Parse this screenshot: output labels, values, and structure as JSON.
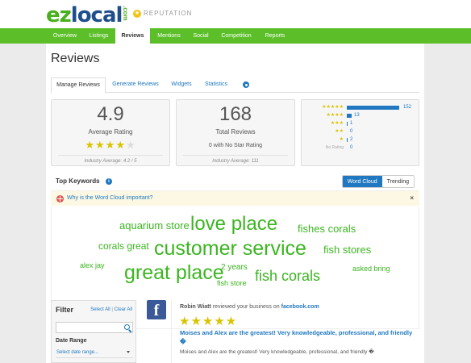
{
  "header": {
    "logo_ez": "ez",
    "logo_local": "local",
    "logo_com": ".com",
    "module_label": "REPUTATION",
    "module_icon": "star-badge-icon"
  },
  "nav": {
    "items": [
      {
        "label": "Overview"
      },
      {
        "label": "Listings"
      },
      {
        "label": "Reviews",
        "active": true
      },
      {
        "label": "Mentions"
      },
      {
        "label": "Social"
      },
      {
        "label": "Competition"
      },
      {
        "label": "Reports"
      }
    ]
  },
  "page": {
    "title": "Reviews",
    "tabs": [
      {
        "label": "Manage Reviews",
        "active": true
      },
      {
        "label": "Generate Reviews"
      },
      {
        "label": "Widgets"
      },
      {
        "label": "Statistics"
      }
    ],
    "settings_icon": "gear-icon"
  },
  "stats": {
    "average": {
      "value": "4.9",
      "label": "Average Rating",
      "stars": 4,
      "footer": "Industry Average: 4.2 / 5"
    },
    "total": {
      "value": "168",
      "label": "Total Reviews",
      "sub": "0 with No Star Rating",
      "footer": "Industry Average: 111"
    },
    "distribution": [
      {
        "label": "★★★★★",
        "count": "152",
        "fraction": 0.905
      },
      {
        "label": "★★★★",
        "count": "13",
        "fraction": 0.077
      },
      {
        "label": "★★★",
        "count": "1",
        "fraction": 0.006
      },
      {
        "label": "★★",
        "count": "0",
        "fraction": 0
      },
      {
        "label": "★",
        "count": "2",
        "fraction": 0.012
      },
      {
        "label": "No Rating",
        "count": "0",
        "fraction": 0
      }
    ]
  },
  "keywords": {
    "title": "Top Keywords",
    "info_icon": "info-icon",
    "toggle": {
      "word_cloud": "Word Cloud",
      "trending": "Trending",
      "active": "word_cloud"
    },
    "why_text": "Why is the Word Cloud important?",
    "why_close": "×",
    "words": [
      "aquarium store",
      "love place",
      "fishes corals",
      "corals great",
      "customer service",
      "fish stores",
      "alex jay",
      "great place",
      "2 years",
      "fish corals",
      "asked bring",
      "fish store"
    ]
  },
  "filter": {
    "title": "Filter",
    "select_all": "Select All",
    "divider": "|",
    "clear_all": "Clear All",
    "search_placeholder": "",
    "date_label": "Date Range",
    "date_value": "Select date range..."
  },
  "review": {
    "source_icon": "facebook-icon",
    "source_glyph": "f",
    "author": "Robin Wiatt",
    "action": " reviewed your business on ",
    "site": "facebook.com",
    "stars": 5,
    "stars_text": "★★★★★",
    "title": "Moises and Alex are the greatest! Very knowledgeable, professional, and friendly �",
    "body": "Moises and Alex are the greatest! Very knowledgeable, professional, and friendly �"
  },
  "colors": {
    "brand_green": "#5cbf2a",
    "link_blue": "#1f78c1",
    "star_yellow": "#d9c400",
    "facebook_blue": "#3b5998"
  }
}
